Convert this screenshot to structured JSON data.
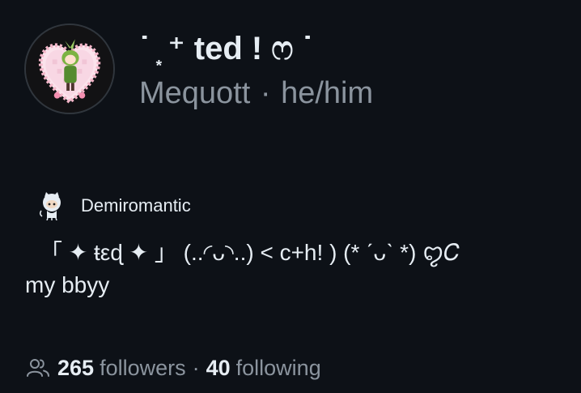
{
  "profile": {
    "display_name": "˙ ͙ ⁺ ted ! ෆ ˙",
    "username": "Mequott",
    "pronouns": "he/him",
    "separator": "·"
  },
  "badge": {
    "label": "Demiromantic",
    "icon": "octocat-icon"
  },
  "bio": {
    "line1": "「 ✦ ŧεɖ ✦ 」 (..◜ᴗ◝..) < c+h! ) (* ˊᴗˋ *) ꨄ𝐶",
    "line2": "my bbyy"
  },
  "stats": {
    "followers_count": "265",
    "followers_label": "followers",
    "separator": "·",
    "following_count": "40",
    "following_label": "following"
  },
  "colors": {
    "background": "#0d1117",
    "text_primary": "#e6edf3",
    "text_muted": "#8b949e",
    "avatar_accent": "#f4b6c9",
    "avatar_green": "#7cb342"
  }
}
